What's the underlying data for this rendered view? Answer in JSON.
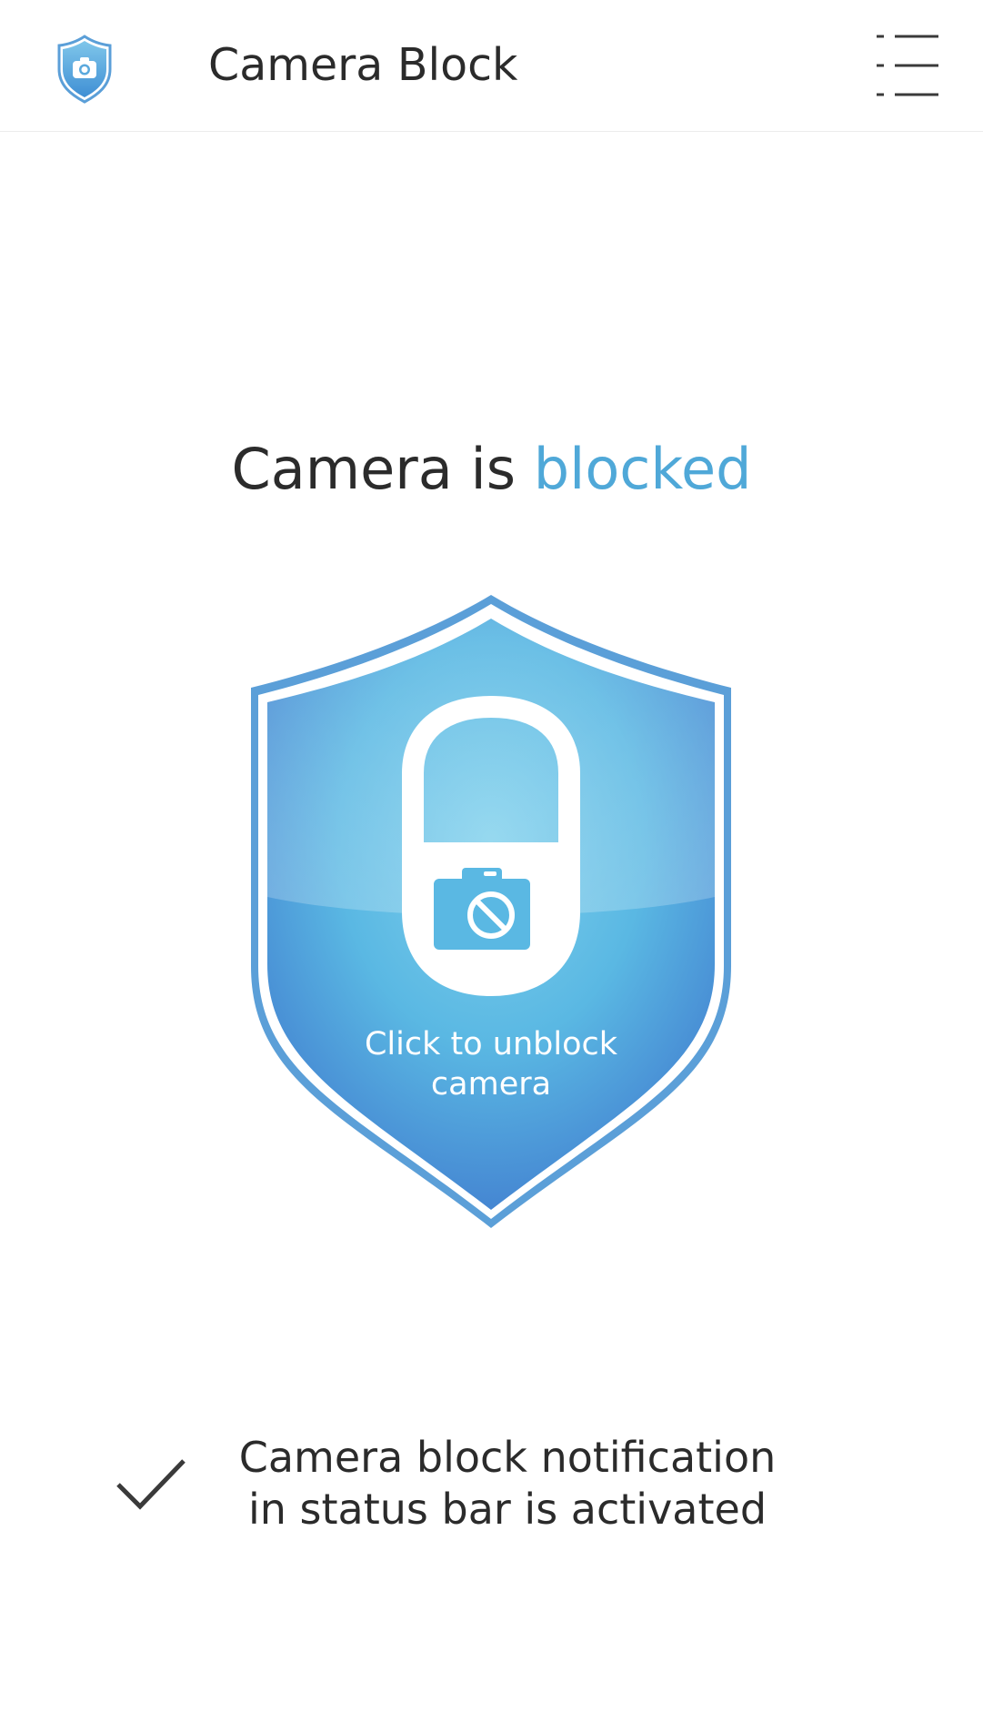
{
  "appbar": {
    "title": "Camera Block",
    "logo_icon": "shield-camera-icon",
    "menu_icon": "list-menu-icon"
  },
  "status": {
    "prefix": "Camera is ",
    "state": "blocked"
  },
  "shield": {
    "icon": "camera-lock-icon",
    "label_line1": "Click to unblock",
    "label_line2": "camera"
  },
  "notification": {
    "icon": "checkmark-icon",
    "line1": "Camera block notification",
    "line2": "in status bar is activated"
  },
  "colors": {
    "accent": "#4fa8d8",
    "shield_outer": "#5b9fd8",
    "shield_fill_light": "#7ec9ea",
    "shield_fill_dark": "#4a8fd6",
    "text": "#2b2b2b"
  }
}
